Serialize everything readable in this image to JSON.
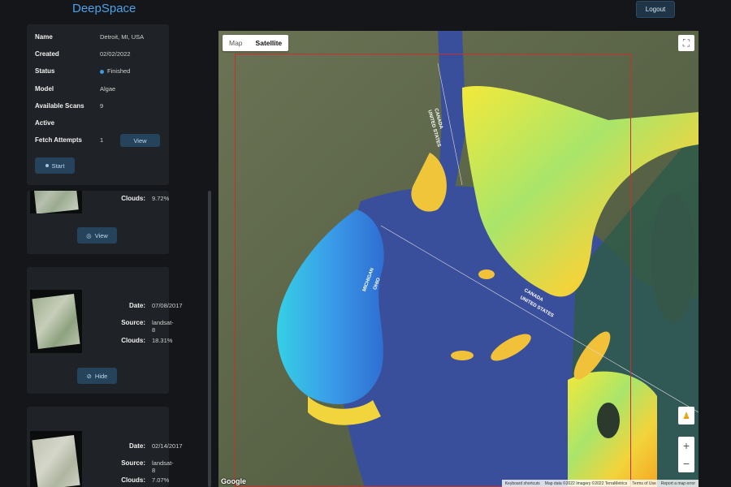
{
  "header": {
    "brand": "DeepSpace",
    "logout": "Logout"
  },
  "info": {
    "name_label": "Name",
    "name_value": "Detroit, MI, USA",
    "created_label": "Created",
    "created_value": "02/02/2022",
    "status_label": "Status",
    "status_value": "Finished",
    "model_label": "Model",
    "model_value": "Algae",
    "scans_label": "Available Scans",
    "scans_value": "9",
    "active_label": "Active",
    "fetch_label": "Fetch Attempts",
    "fetch_value": "1",
    "view_label": "View",
    "start_label": "Start"
  },
  "scans": [
    {
      "clouds_label": "Clouds:",
      "clouds": "9.72%",
      "action": "View"
    },
    {
      "date_label": "Date:",
      "date": "07/08/2017",
      "source_label": "Source:",
      "source": "landsat-8",
      "clouds_label": "Clouds:",
      "clouds": "18.31%",
      "action": "Hide"
    },
    {
      "date_label": "Date:",
      "date": "02/14/2017",
      "source_label": "Source:",
      "source": "landsat-8",
      "clouds_label": "Clouds:",
      "clouds": "7.07%"
    }
  ],
  "map": {
    "type_map": "Map",
    "type_satellite": "Satellite",
    "google": "Google",
    "attribution": [
      "Keyboard shortcuts",
      "Map data ©2022 Imagery ©2022 TerraMetrics",
      "Terms of Use",
      "Report a map error"
    ],
    "border_label_1": "CANADA",
    "border_label_2": "UNITED STATES",
    "border_label_3": "MICHIGAN",
    "border_label_4": "OHIO"
  }
}
